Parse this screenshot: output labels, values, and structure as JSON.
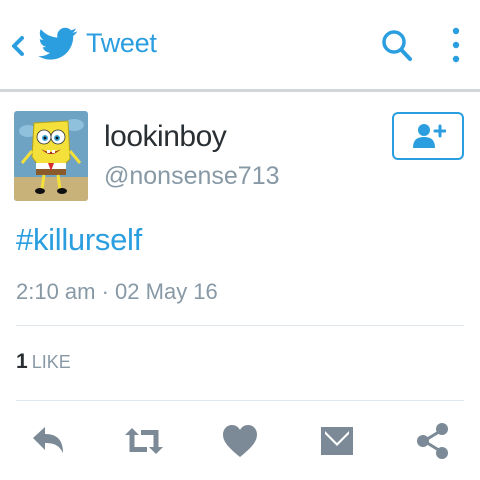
{
  "header": {
    "title": "Tweet",
    "back_icon": "chevron-left-icon",
    "logo_icon": "twitter-bird-icon",
    "search_icon": "search-icon",
    "more_icon": "vertical-dots-icon"
  },
  "tweet": {
    "author_name": "lookinboy",
    "author_handle": "@nonsense713",
    "text": "#killurself",
    "timestamp": "2:10 am · 02 May 16",
    "like_count": "1",
    "like_label": "LIKE"
  },
  "actions": [
    "reply-icon",
    "retweet-icon",
    "heart-icon",
    "direct-message-icon",
    "share-icon"
  ],
  "colors": {
    "accent": "#2b9ee0",
    "text_primary": "#292f33",
    "text_secondary": "#8899a6",
    "action_gray": "#7b8a96",
    "divider": "#e1e8ed"
  }
}
